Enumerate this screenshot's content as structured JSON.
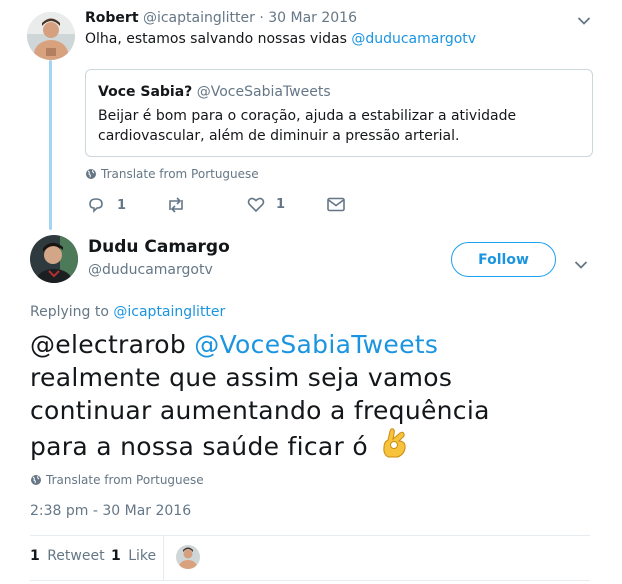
{
  "reply_tweet": {
    "name": "Robert",
    "handle": "@icaptainglitter",
    "separator": "·",
    "date": "30 Mar 2016",
    "text_prefix": "Olha, estamos salvando nossas vidas",
    "mention": "@duducamargotv",
    "translate": "Translate from Portuguese",
    "reply_count": "1",
    "like_count": "1"
  },
  "quoted_tweet": {
    "name": "Voce Sabia?",
    "handle": "@VoceSabiaTweets",
    "text_line1": "Beijar é bom para o coração, ajuda a estabilizar a atividade",
    "text_line2": "cardiovascular, além de diminuir a pressão arterial."
  },
  "main_tweet": {
    "name": "Dudu Camargo",
    "handle": "@duducamargotv",
    "follow_label": "Follow",
    "replying_to_label": "Replying to",
    "replying_to_handle": "@icaptainglitter",
    "mention1": "@electrarob",
    "mention2": "@VoceSabiaTweets",
    "text_line2": "realmente que assim seja vamos",
    "text_line3": "continuar aumentando a frequência",
    "text_line4": "para a nossa saúde ficar ó",
    "emoji": "👌",
    "translate": "Translate from Portuguese",
    "timestamp": "2:38 pm - 30 Mar 2016",
    "retweet_count": "1",
    "retweet_label": "Retweet",
    "like_count": "1",
    "like_label": "Like"
  },
  "colors": {
    "link": "#1b95e0",
    "muted": "#657786",
    "thread_line": "#a4d5f5"
  }
}
